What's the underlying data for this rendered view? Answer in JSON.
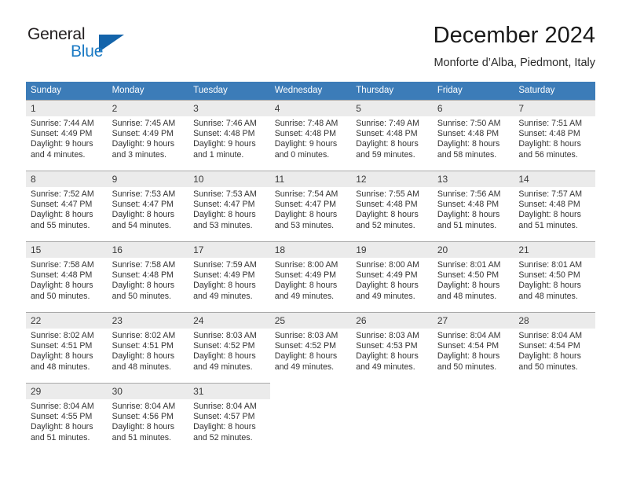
{
  "brand": {
    "word1": "General",
    "word2": "Blue",
    "accent_color": "#1b7ac4",
    "triangle_color": "#1464aa"
  },
  "header": {
    "title": "December 2024",
    "location": "Monforte d’Alba, Piedmont, Italy"
  },
  "theme": {
    "header_bg": "#3c7cb8",
    "header_text": "#ffffff",
    "daynum_bg": "#ebebeb",
    "body_text": "#333333",
    "cell_border": "#a9a9a9"
  },
  "weekday_headers": [
    "Sunday",
    "Monday",
    "Tuesday",
    "Wednesday",
    "Thursday",
    "Friday",
    "Saturday"
  ],
  "weeks": [
    [
      {
        "day": "1",
        "sunrise": "Sunrise: 7:44 AM",
        "sunset": "Sunset: 4:49 PM",
        "daylight1": "Daylight: 9 hours",
        "daylight2": "and 4 minutes."
      },
      {
        "day": "2",
        "sunrise": "Sunrise: 7:45 AM",
        "sunset": "Sunset: 4:49 PM",
        "daylight1": "Daylight: 9 hours",
        "daylight2": "and 3 minutes."
      },
      {
        "day": "3",
        "sunrise": "Sunrise: 7:46 AM",
        "sunset": "Sunset: 4:48 PM",
        "daylight1": "Daylight: 9 hours",
        "daylight2": "and 1 minute."
      },
      {
        "day": "4",
        "sunrise": "Sunrise: 7:48 AM",
        "sunset": "Sunset: 4:48 PM",
        "daylight1": "Daylight: 9 hours",
        "daylight2": "and 0 minutes."
      },
      {
        "day": "5",
        "sunrise": "Sunrise: 7:49 AM",
        "sunset": "Sunset: 4:48 PM",
        "daylight1": "Daylight: 8 hours",
        "daylight2": "and 59 minutes."
      },
      {
        "day": "6",
        "sunrise": "Sunrise: 7:50 AM",
        "sunset": "Sunset: 4:48 PM",
        "daylight1": "Daylight: 8 hours",
        "daylight2": "and 58 minutes."
      },
      {
        "day": "7",
        "sunrise": "Sunrise: 7:51 AM",
        "sunset": "Sunset: 4:48 PM",
        "daylight1": "Daylight: 8 hours",
        "daylight2": "and 56 minutes."
      }
    ],
    [
      {
        "day": "8",
        "sunrise": "Sunrise: 7:52 AM",
        "sunset": "Sunset: 4:47 PM",
        "daylight1": "Daylight: 8 hours",
        "daylight2": "and 55 minutes."
      },
      {
        "day": "9",
        "sunrise": "Sunrise: 7:53 AM",
        "sunset": "Sunset: 4:47 PM",
        "daylight1": "Daylight: 8 hours",
        "daylight2": "and 54 minutes."
      },
      {
        "day": "10",
        "sunrise": "Sunrise: 7:53 AM",
        "sunset": "Sunset: 4:47 PM",
        "daylight1": "Daylight: 8 hours",
        "daylight2": "and 53 minutes."
      },
      {
        "day": "11",
        "sunrise": "Sunrise: 7:54 AM",
        "sunset": "Sunset: 4:47 PM",
        "daylight1": "Daylight: 8 hours",
        "daylight2": "and 53 minutes."
      },
      {
        "day": "12",
        "sunrise": "Sunrise: 7:55 AM",
        "sunset": "Sunset: 4:48 PM",
        "daylight1": "Daylight: 8 hours",
        "daylight2": "and 52 minutes."
      },
      {
        "day": "13",
        "sunrise": "Sunrise: 7:56 AM",
        "sunset": "Sunset: 4:48 PM",
        "daylight1": "Daylight: 8 hours",
        "daylight2": "and 51 minutes."
      },
      {
        "day": "14",
        "sunrise": "Sunrise: 7:57 AM",
        "sunset": "Sunset: 4:48 PM",
        "daylight1": "Daylight: 8 hours",
        "daylight2": "and 51 minutes."
      }
    ],
    [
      {
        "day": "15",
        "sunrise": "Sunrise: 7:58 AM",
        "sunset": "Sunset: 4:48 PM",
        "daylight1": "Daylight: 8 hours",
        "daylight2": "and 50 minutes."
      },
      {
        "day": "16",
        "sunrise": "Sunrise: 7:58 AM",
        "sunset": "Sunset: 4:48 PM",
        "daylight1": "Daylight: 8 hours",
        "daylight2": "and 50 minutes."
      },
      {
        "day": "17",
        "sunrise": "Sunrise: 7:59 AM",
        "sunset": "Sunset: 4:49 PM",
        "daylight1": "Daylight: 8 hours",
        "daylight2": "and 49 minutes."
      },
      {
        "day": "18",
        "sunrise": "Sunrise: 8:00 AM",
        "sunset": "Sunset: 4:49 PM",
        "daylight1": "Daylight: 8 hours",
        "daylight2": "and 49 minutes."
      },
      {
        "day": "19",
        "sunrise": "Sunrise: 8:00 AM",
        "sunset": "Sunset: 4:49 PM",
        "daylight1": "Daylight: 8 hours",
        "daylight2": "and 49 minutes."
      },
      {
        "day": "20",
        "sunrise": "Sunrise: 8:01 AM",
        "sunset": "Sunset: 4:50 PM",
        "daylight1": "Daylight: 8 hours",
        "daylight2": "and 48 minutes."
      },
      {
        "day": "21",
        "sunrise": "Sunrise: 8:01 AM",
        "sunset": "Sunset: 4:50 PM",
        "daylight1": "Daylight: 8 hours",
        "daylight2": "and 48 minutes."
      }
    ],
    [
      {
        "day": "22",
        "sunrise": "Sunrise: 8:02 AM",
        "sunset": "Sunset: 4:51 PM",
        "daylight1": "Daylight: 8 hours",
        "daylight2": "and 48 minutes."
      },
      {
        "day": "23",
        "sunrise": "Sunrise: 8:02 AM",
        "sunset": "Sunset: 4:51 PM",
        "daylight1": "Daylight: 8 hours",
        "daylight2": "and 48 minutes."
      },
      {
        "day": "24",
        "sunrise": "Sunrise: 8:03 AM",
        "sunset": "Sunset: 4:52 PM",
        "daylight1": "Daylight: 8 hours",
        "daylight2": "and 49 minutes."
      },
      {
        "day": "25",
        "sunrise": "Sunrise: 8:03 AM",
        "sunset": "Sunset: 4:52 PM",
        "daylight1": "Daylight: 8 hours",
        "daylight2": "and 49 minutes."
      },
      {
        "day": "26",
        "sunrise": "Sunrise: 8:03 AM",
        "sunset": "Sunset: 4:53 PM",
        "daylight1": "Daylight: 8 hours",
        "daylight2": "and 49 minutes."
      },
      {
        "day": "27",
        "sunrise": "Sunrise: 8:04 AM",
        "sunset": "Sunset: 4:54 PM",
        "daylight1": "Daylight: 8 hours",
        "daylight2": "and 50 minutes."
      },
      {
        "day": "28",
        "sunrise": "Sunrise: 8:04 AM",
        "sunset": "Sunset: 4:54 PM",
        "daylight1": "Daylight: 8 hours",
        "daylight2": "and 50 minutes."
      }
    ],
    [
      {
        "day": "29",
        "sunrise": "Sunrise: 8:04 AM",
        "sunset": "Sunset: 4:55 PM",
        "daylight1": "Daylight: 8 hours",
        "daylight2": "and 51 minutes."
      },
      {
        "day": "30",
        "sunrise": "Sunrise: 8:04 AM",
        "sunset": "Sunset: 4:56 PM",
        "daylight1": "Daylight: 8 hours",
        "daylight2": "and 51 minutes."
      },
      {
        "day": "31",
        "sunrise": "Sunrise: 8:04 AM",
        "sunset": "Sunset: 4:57 PM",
        "daylight1": "Daylight: 8 hours",
        "daylight2": "and 52 minutes."
      },
      {
        "day": "",
        "sunrise": "",
        "sunset": "",
        "daylight1": "",
        "daylight2": ""
      },
      {
        "day": "",
        "sunrise": "",
        "sunset": "",
        "daylight1": "",
        "daylight2": ""
      },
      {
        "day": "",
        "sunrise": "",
        "sunset": "",
        "daylight1": "",
        "daylight2": ""
      },
      {
        "day": "",
        "sunrise": "",
        "sunset": "",
        "daylight1": "",
        "daylight2": ""
      }
    ]
  ]
}
